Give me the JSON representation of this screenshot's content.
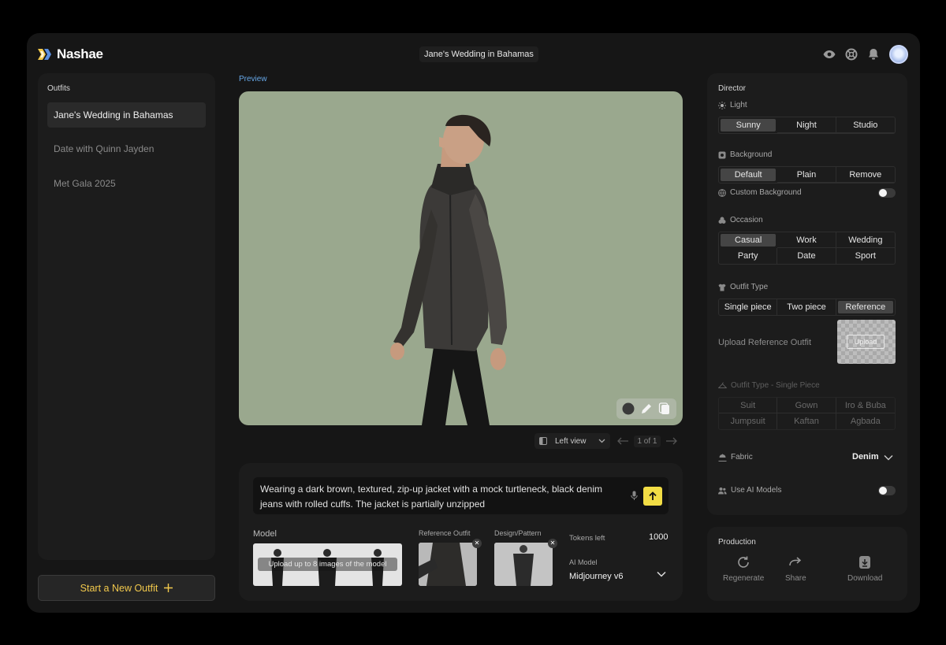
{
  "app": {
    "name": "Nashae"
  },
  "header": {
    "title": "Jane's Wedding in Bahamas"
  },
  "outfits": {
    "title": "Outfits",
    "items": [
      "Jane's Wedding in Bahamas",
      "Date with  Quinn Jayden",
      "Met Gala 2025"
    ],
    "new_outfit_label": "Start a New Outfit"
  },
  "preview": {
    "label": "Preview",
    "view_label": "Left view",
    "pager": "1 of 1"
  },
  "prompt": {
    "text": "Wearing a dark brown, textured, zip-up jacket with a mock turtleneck, black denim jeans with rolled cuffs. The jacket is partially unzipped",
    "model_label": "Model",
    "model_upload_hint": "Upload up to 8 images of the model",
    "reference_label": "Reference Outfit",
    "design_label": "Design/Pattern",
    "tokens_label": "Tokens left",
    "tokens_value": "1000",
    "ai_model_label": "AI Model",
    "ai_model_value": "Midjourney v6"
  },
  "director": {
    "title": "Director",
    "light": {
      "title": "Light",
      "options": [
        "Sunny",
        "Night",
        "Studio"
      ],
      "selected": "Sunny"
    },
    "background": {
      "title": "Background",
      "options": [
        "Default",
        "Plain",
        "Remove"
      ],
      "selected": "Default"
    },
    "custom_background": {
      "label": "Custom Background",
      "enabled": false
    },
    "occasion": {
      "title": "Occasion",
      "options": [
        "Casual",
        "Work",
        "Wedding",
        "Party",
        "Date",
        "Sport"
      ],
      "selected": "Casual"
    },
    "outfit_type": {
      "title": "Outfit Type",
      "options": [
        "Single piece",
        "Two piece",
        "Reference"
      ],
      "selected": "Reference"
    },
    "upload_reference": {
      "label": "Upload Reference Outfit",
      "button": "Upload"
    },
    "single_piece": {
      "title": "Outfit Type - Single Piece",
      "options": [
        "Suit",
        "Gown",
        "Iro & Buba",
        "Jumpsuit",
        "Kaftan",
        "Agbada"
      ]
    },
    "fabric": {
      "title": "Fabric",
      "value": "Denim"
    },
    "use_ai_models": {
      "label": "Use AI Models",
      "enabled": false
    }
  },
  "production": {
    "title": "Production",
    "actions": [
      "Regenerate",
      "Share",
      "Download"
    ]
  },
  "colors": {
    "accent_yellow": "#f2dd45",
    "preview_bg": "#9aa88e",
    "preview_label": "#67a8e8"
  }
}
